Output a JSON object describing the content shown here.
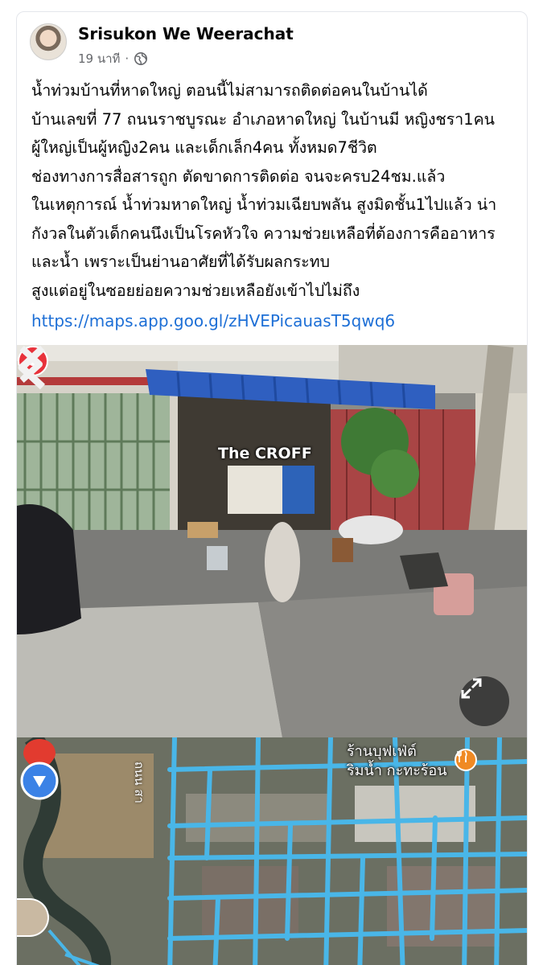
{
  "post": {
    "author": "Srisukon We Weerachat",
    "time": "19 นาที",
    "separator": "·",
    "privacy_icon": "globe-icon",
    "body": "น้ำท่วมบ้านที่หาดใหญ่ ตอนนี้ไม่สามารถติดต่อคนในบ้านได้\nบ้านเลขที่ 77 ถนนราชบูรณะ อำเภอหาดใหญ่ ในบ้านมี หญิงชรา1คน ผู้ใหญ่เป็นผู้หญิง2คน และเด็กเล็ก4คน ทั้งหมด7ชีวิต\nช่องทางการสื่อสารถูก ตัดขาดการติดต่อ จนจะครบ24ชม.แล้ว\nในเหตุการณ์ น้ำท่วมหาดใหญ่ น้ำท่วมเฉียบพลัน สูงมิดชั้น1ไปแล้ว น่ากังวลในตัวเด็กคนนึงเป็นโรคหัวใจ ความช่วยเหลือที่ต้องการคืออาหารและน้ำ เพราะเป็นย่านอาศัยที่ได้รับผลกระทบ\nสูงแต่อยู่ในซอยย่อยความช่วยเหลือยังเข้าไปไม่ถึง",
    "link": "https://maps.app.goo.gl/zHVEPicauasT5qwq6"
  },
  "street_view": {
    "place_name": "The CROFF",
    "awning_text": "CROFF",
    "expand_icon": "expand-icon"
  },
  "map": {
    "poi_label_line1": "ร้านบุฟเฟ่ต์",
    "poi_label_line2": "ริมน้ำ กะทะร้อน",
    "poi_icon": "restaurant-icon",
    "road_label": "ถนน สา",
    "road_color": "#49b6e8"
  }
}
